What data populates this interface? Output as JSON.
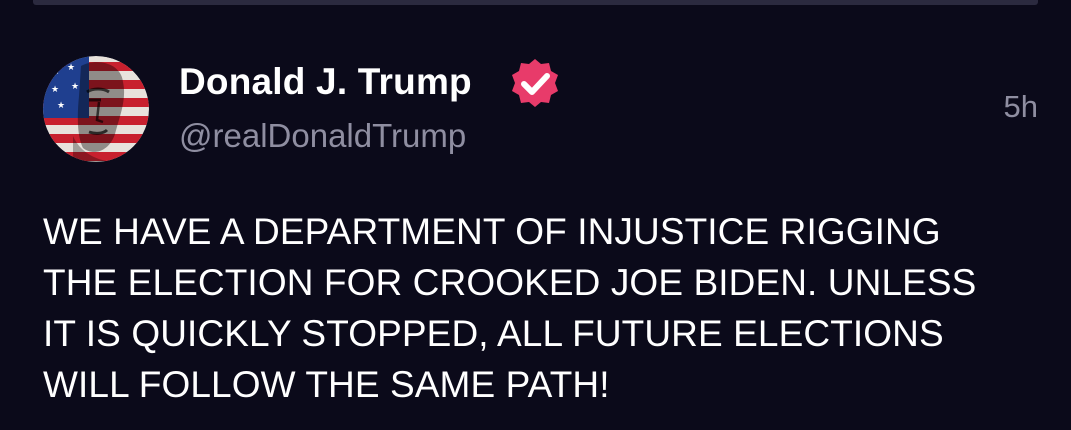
{
  "post": {
    "author": {
      "display_name": "Donald J. Trump",
      "handle": "@realDonaldTrump",
      "verified": true,
      "avatar_icon": "flag-portrait-avatar",
      "verified_icon": "verified-badge-icon"
    },
    "time_ago": "5h",
    "lines": [
      "WE HAVE A DEPARTMENT OF INJUSTICE RIGGING",
      "THE ELECTION FOR CROOKED JOE BIDEN. UNLESS",
      "IT IS QUICKLY STOPPED, ALL FUTURE ELECTIONS",
      "WILL FOLLOW THE SAME PATH!"
    ]
  },
  "colors": {
    "background": "#0b0a1a",
    "text_primary": "#ffffff",
    "text_secondary": "#8f8ea1",
    "verified_badge": "#e83b6a",
    "divider": "#2b2a3f"
  }
}
